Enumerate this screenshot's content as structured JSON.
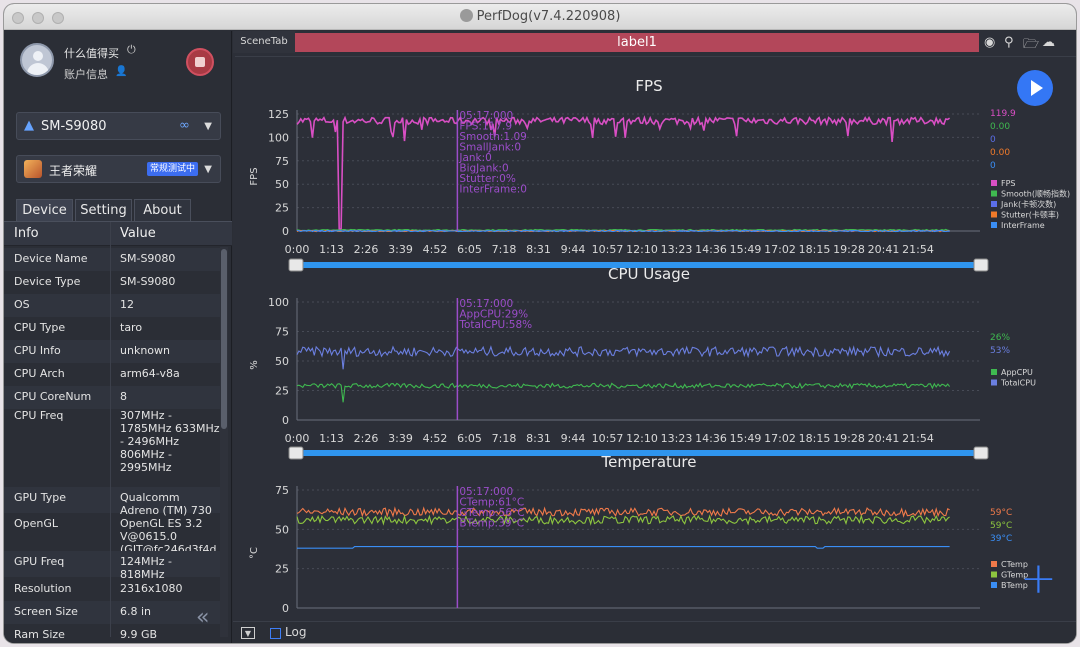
{
  "window": {
    "title": "PerfDog(v7.4.220908)"
  },
  "account": {
    "username": "什么值得买",
    "account_label": "账户信息"
  },
  "device": {
    "name": "SM-S9080"
  },
  "app": {
    "name": "王者荣耀",
    "mode_badge": "常规测试中"
  },
  "tabs": [
    {
      "label": "Device"
    },
    {
      "label": "Setting"
    },
    {
      "label": "About"
    }
  ],
  "info_table": {
    "headers": [
      "Info",
      "Value"
    ],
    "rows": [
      {
        "key": "Device Name",
        "value": "SM-S9080"
      },
      {
        "key": "Device Type",
        "value": "SM-S9080"
      },
      {
        "key": "OS",
        "value": "12"
      },
      {
        "key": "CPU Type",
        "value": "taro"
      },
      {
        "key": "CPU Info",
        "value": "unknown"
      },
      {
        "key": "CPU Arch",
        "value": "arm64-v8a"
      },
      {
        "key": "CPU CoreNum",
        "value": "8"
      },
      {
        "key": "CPU Freq",
        "value": "307MHz - 1785MHz 633MHz - 2496MHz 806MHz - 2995MHz"
      },
      {
        "key": "GPU Type",
        "value": "Qualcomm Adreno (TM) 730"
      },
      {
        "key": "OpenGL",
        "value": "OpenGL ES 3.2 V@0615.0 (GIT@fc246d3f4d"
      },
      {
        "key": "GPU Freq",
        "value": "124MHz - 818MHz"
      },
      {
        "key": "Resolution",
        "value": "2316x1080"
      },
      {
        "key": "Screen Size",
        "value": "6.8 in"
      },
      {
        "key": "Ram Size",
        "value": "9.9 GB"
      }
    ]
  },
  "scene": {
    "tab_label": "SceneTab",
    "label": "label1"
  },
  "bottom": {
    "log_label": "Log"
  },
  "colors": {
    "fps": "#d94fc4",
    "smooth": "#3fb950",
    "jank": "#5b6ee8",
    "stutter": "#f07a2a",
    "interframe": "#3a8ef5",
    "app_cpu": "#3fb950",
    "total_cpu": "#6b7fe0",
    "ctemp": "#f07a4a",
    "gtemp": "#8dc63f",
    "btemp": "#3a8ef5",
    "cursor": "#9b4dc9",
    "slider": "#2f95ee"
  },
  "icons": [
    "location-icon",
    "pin-icon",
    "folder-icon",
    "cloud-icon",
    "play-icon",
    "plus-icon",
    "android-icon",
    "link-icon",
    "power-icon",
    "record-icon"
  ],
  "chart_data": [
    {
      "type": "line",
      "title": "FPS",
      "ylabel": "FPS",
      "ylim": [
        0,
        125
      ],
      "yticks": [
        0,
        25,
        50,
        75,
        100,
        125
      ],
      "x_ticks": [
        "0:00",
        "1:13",
        "2:26",
        "3:39",
        "4:52",
        "6:05",
        "7:18",
        "8:31",
        "9:44",
        "10:57",
        "12:10",
        "13:23",
        "14:36",
        "15:49",
        "17:02",
        "18:15",
        "19:28",
        "20:41",
        "21:54"
      ],
      "series": [
        {
          "name": "FPS",
          "approx_value": 117.9,
          "current": "119.9"
        },
        {
          "name": "Smooth(顺畅指数)",
          "approx_value": 1.09,
          "current": "0.00"
        },
        {
          "name": "Jank(卡顿次数)",
          "approx_value": 0,
          "current": "0"
        },
        {
          "name": "Stutter(卡顿率)",
          "approx_value": 0,
          "current": "0.00"
        },
        {
          "name": "InterFrame",
          "approx_value": 0,
          "current": "0"
        }
      ],
      "cursor": {
        "time": "05:17:000",
        "lines": [
          "05:17:000",
          "FPS:117.9",
          "Smooth:1.09",
          "SmallJank:0",
          "Jank:0",
          "BigJank:0",
          "Stutter:0%",
          "InterFrame:0"
        ]
      }
    },
    {
      "type": "line",
      "title": "CPU Usage",
      "ylabel": "%",
      "ylim": [
        0,
        100
      ],
      "yticks": [
        0,
        25,
        50,
        75,
        100
      ],
      "x_ticks": [
        "0:00",
        "1:13",
        "2:26",
        "3:39",
        "4:52",
        "6:05",
        "7:18",
        "8:31",
        "9:44",
        "10:57",
        "12:10",
        "13:23",
        "14:36",
        "15:49",
        "17:02",
        "18:15",
        "19:28",
        "20:41",
        "21:54"
      ],
      "series": [
        {
          "name": "AppCPU",
          "approx_value": 29,
          "current": "26%"
        },
        {
          "name": "TotalCPU",
          "approx_value": 58,
          "current": "53%"
        }
      ],
      "cursor": {
        "time": "05:17:000",
        "lines": [
          "05:17:000",
          "AppCPU:29%",
          "TotalCPU:58%"
        ]
      }
    },
    {
      "type": "line",
      "title": "Temperature",
      "ylabel": "°C",
      "ylim": [
        0,
        75
      ],
      "yticks": [
        0,
        25,
        50,
        75
      ],
      "x_ticks": [
        "0:00",
        "1:13",
        "2:26",
        "3:39",
        "4:52",
        "6:05",
        "7:18",
        "8:31",
        "9:44",
        "10:57",
        "12:10",
        "13:23",
        "14:36",
        "15:49",
        "17:02",
        "18:15",
        "19:28",
        "20:41",
        "21:54"
      ],
      "series": [
        {
          "name": "CTemp",
          "approx_value": 61,
          "current": "59°C"
        },
        {
          "name": "GTemp",
          "approx_value": 56,
          "current": "59°C"
        },
        {
          "name": "BTemp",
          "approx_value": 39,
          "current": "39°C"
        }
      ],
      "cursor": {
        "time": "05:17:000",
        "lines": [
          "05:17:000",
          "CTemp:61°C",
          "GTemp:56°C",
          "BTemp:39°C"
        ]
      }
    }
  ]
}
